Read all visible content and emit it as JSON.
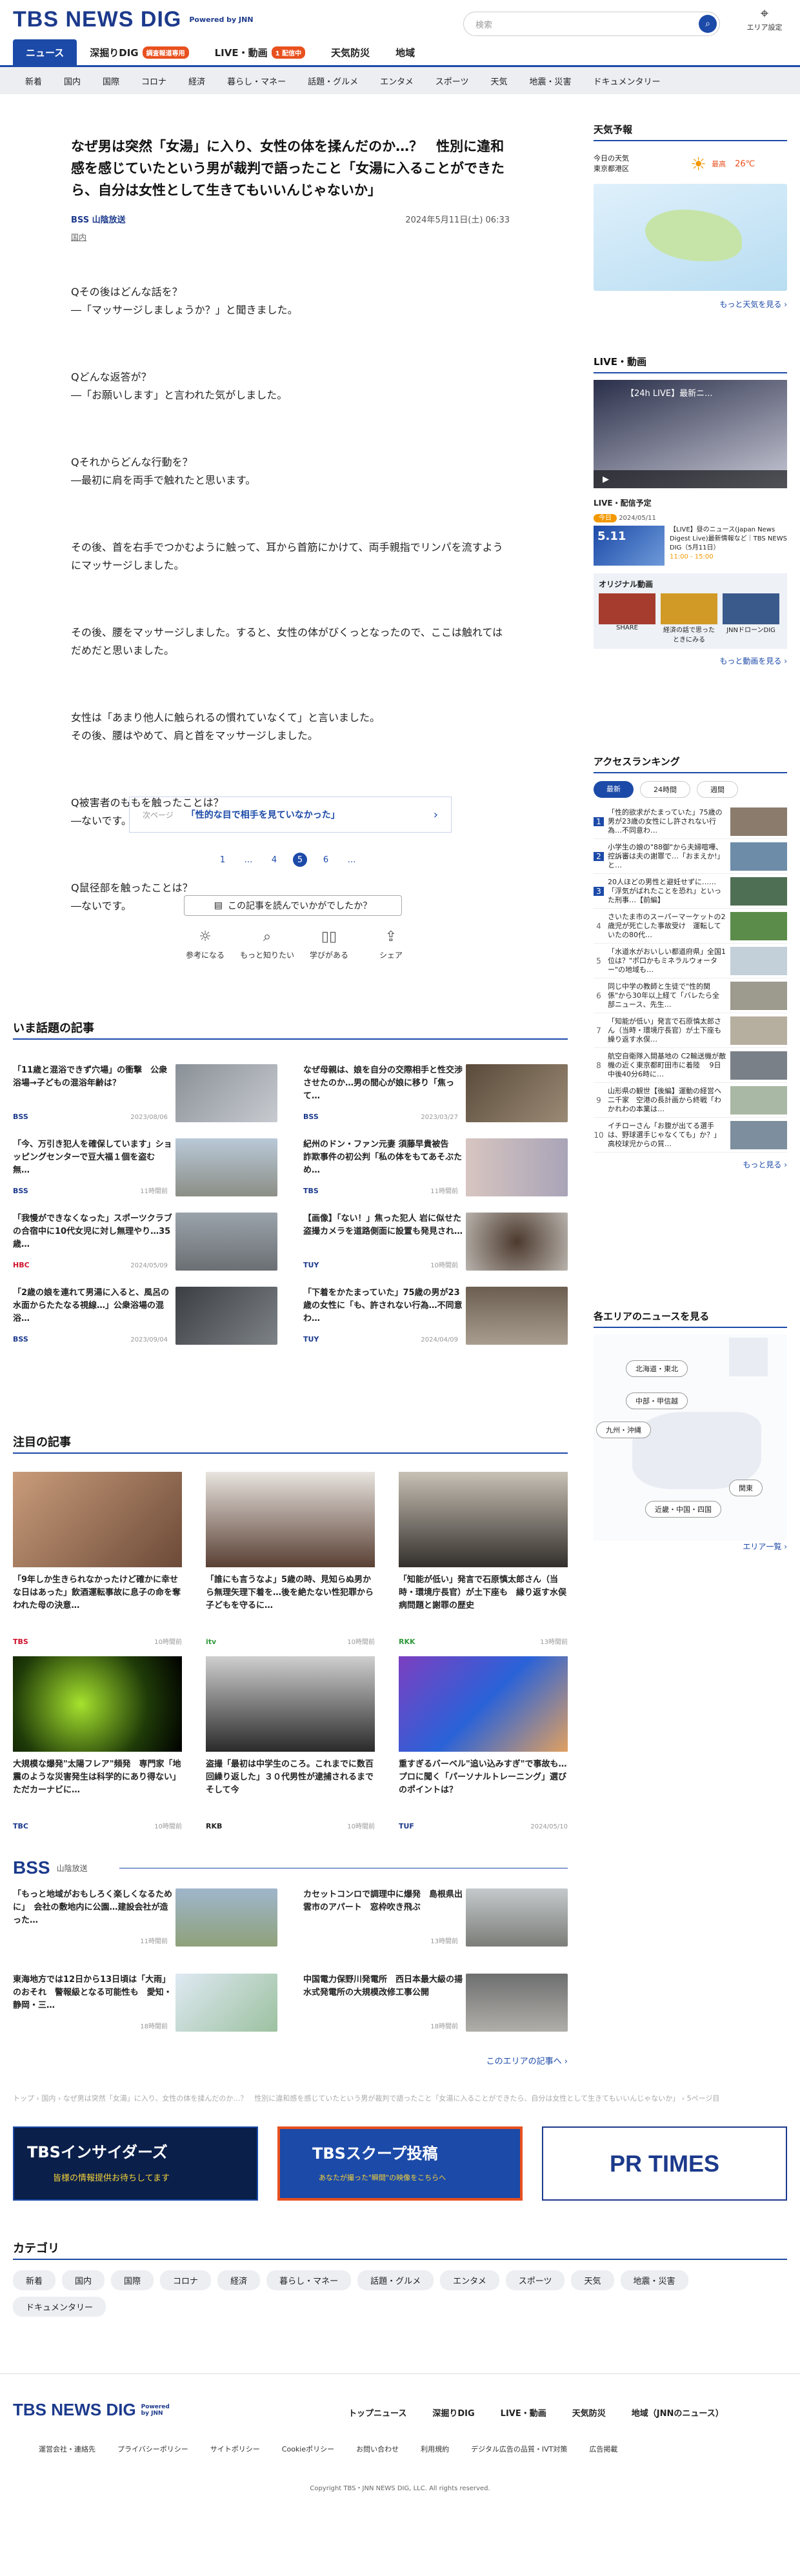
{
  "header": {
    "logo": "TBS NEWS DIG",
    "powered": "Powered by JNN",
    "search_placeholder": "検索",
    "area_label": "エリア設定"
  },
  "main_nav": [
    {
      "label": "ニュース",
      "active": true
    },
    {
      "label": "深掘りDIG",
      "badge": "調査報道専用"
    },
    {
      "label": "LIVE・動画",
      "badge": "1 配信中"
    },
    {
      "label": "天気防災"
    },
    {
      "label": "地域"
    }
  ],
  "sub_nav": [
    "新着",
    "国内",
    "国際",
    "コロナ",
    "経済",
    "暮らし・マネー",
    "話題・グルメ",
    "エンタメ",
    "スポーツ",
    "天気",
    "地震・災害",
    "ドキュメンタリー"
  ],
  "article": {
    "title": "なぜ男は突然「女湯」に入り、女性の体を揉んだのか…？　性別に違和感を感じていたという男が裁判で語ったこと「女湯に入ることができたら、自分は女性として生きてもいいんじゃないか」",
    "source": "BSS 山陰放送",
    "date": "2024年5月11日(土) 06:33",
    "category": "国内",
    "paragraphs": [
      "Qその後はどんな話を？\n―「マッサージしましょうか？」と聞きました。",
      "Qどんな返答が？\n―「お願いします」と言われた気がしました。",
      "Qそれからどんな行動を？\n―最初に肩を両手で触れたと思います。",
      "その後、首を右手でつかむように触って、耳から首筋にかけて、両手親指でリンパを流すようにマッサージしました。",
      "その後、腰をマッサージしました。すると、女性の体がびくっとなったので、ここは触れてはだめだと思いました。",
      "女性は「あまり他人に触られるの慣れていなくて」と言いました。\nその後、腰はやめて、肩と首をマッサージしました。",
      "Q被害者のももを触ったことは？\n―ないです。",
      "Q鼠径部を触ったことは？\n―ないです。"
    ],
    "next_label": "次ページ",
    "next_title": "「性的な目で相手を見ていなかった」",
    "pager": [
      "1",
      "…",
      "4",
      "5",
      "6",
      "…"
    ],
    "feedback_q": "この記事を読んでいかがでしたか？",
    "reactions": [
      "参考になる",
      "もっと知りたい",
      "学びがある",
      "シェア"
    ]
  },
  "trending": {
    "title": "いま話題の記事",
    "items": [
      {
        "text": "「11歳と混浴できず穴場」の衝撃　公衆浴場→子どもの混浴年齢は？",
        "src": "BSS",
        "date": "2023/08/06"
      },
      {
        "text": "なぜ母親は、娘を自分の交際相手と性交渉させたのか…男の間心が娘に移り「焦って…",
        "src": "BSS",
        "date": "2023/03/27"
      },
      {
        "text": "「今、万引き犯人を確保しています」ショッピングセンターで豆大福１個を盗む　無…",
        "src": "BSS",
        "date": "11時間前"
      },
      {
        "text": "紀州のドン・ファン元妻 須藤早貴被告　詐欺事件の初公判「私の体をもてあそぶため…",
        "src": "TBS",
        "date": "11時間前"
      },
      {
        "text": "「我慢ができなくなった」スポーツクラブの合宿中に10代女児に対し無理やり…35歳…",
        "src": "HBC",
        "date": "2024/05/09"
      },
      {
        "text": "【画像】「ない！」焦った犯人 岩に似せた盗撮カメラを道路側面に設置も発見され…",
        "src": "TUY",
        "date": "10時間前"
      },
      {
        "text": "「2歳の娘を連れて男湯に入ると、風呂の水面からたたなる視線…」公衆浴場の混浴…",
        "src": "BSS",
        "date": "2023/09/04"
      },
      {
        "text": "「下着をかたまっていた」75歳の男が23歳の女性に「も、許されない行為…不同意わ…",
        "src": "TUY",
        "date": "2024/04/09"
      }
    ]
  },
  "notable": {
    "title": "注目の記事",
    "items": [
      {
        "text": "「9年しか生きられなかったけど確かに幸せな日はあった」飲酒運転事故に息子の命を奪われた母の決意…",
        "src": "TBS",
        "date": "10時間前"
      },
      {
        "text": "「誰にも言うなよ」5歳の時、見知らぬ男から無理矢理下着を…後を絶たない性犯罪から子どもを守るに…",
        "src": "itv",
        "date": "10時間前"
      },
      {
        "text": "「知能が低い」発言で石原慎太郎さん（当時・環境庁長官）が土下座も　縁り返す水俣病問題と謝罪の歴史",
        "src": "RKK",
        "date": "13時間前"
      },
      {
        "text": "大規模な爆発\"太陽フレア\"頻発　専門家「地震のような災害発生は科学的にあり得ない」ただカーナビに…",
        "src": "TBC",
        "date": "10時間前"
      },
      {
        "text": "盗撮「最初は中学生のころ。これまでに数百回繰り返した」３０代男性が逮捕されるまで　そして今",
        "src": "RKB",
        "date": "10時間前"
      },
      {
        "text": "重すぎるバーベル\"追い込みすぎ\"で事故も…プロに聞く「パーソナルトレーニング」選びのポイントは？",
        "src": "TUF",
        "date": "2024/05/10"
      }
    ]
  },
  "local": {
    "logo": "BSS",
    "title": "山陰放送",
    "items": [
      {
        "text": "「もっと地域がおもしろく楽しくなるために」　会社の敷地内に公園…建設会社が造った…",
        "date": "11時間前"
      },
      {
        "text": "カセットコンロで調理中に爆発　島根県出雲市のアパート　窓枠吹き飛ぶ",
        "date": "13時間前"
      },
      {
        "text": "東海地方では12日から13日頃は「大雨」のおそれ　警報級となる可能性も　愛知・静岡・三…",
        "date": "18時間前"
      },
      {
        "text": "中国電力保野川発電所　西日本最大級の揚水式発電所の大規模改修工事公開",
        "date": "18時間前"
      }
    ],
    "more": "このエリアの記事へ ›"
  },
  "breadcrumb": "トップ › 国内 › なぜ男は突然「女湯」に入り、女性の体を揉んだのか…？　性別に違和感を感じていたという男が裁判で語ったこと「女湯に入ることができたら、自分は女性として生きてもいいんじゃないか」 › 5ページ目",
  "banners": [
    {
      "title": "TBSインサイダーズ",
      "sub": "皆様の情報提供お待ちしてます"
    },
    {
      "title": "TBSスクープ投稿",
      "sub": "あなたが撮った\"瞬間\"の映像をこちらへ"
    },
    {
      "title": "PR TIMES"
    }
  ],
  "categories": {
    "title": "カテゴリ",
    "items": [
      "新着",
      "国内",
      "国際",
      "コロナ",
      "経済",
      "暮らし・マネー",
      "話題・グルメ",
      "エンタメ",
      "スポーツ",
      "天気",
      "地震・災害",
      "ドキュメンタリー"
    ]
  },
  "sidebar": {
    "weather": {
      "title": "天気予報",
      "today": "今日の天気",
      "region": "東京都港区",
      "high_label": "最高",
      "high": "26℃",
      "more": "もっと天気を見る ›"
    },
    "live": {
      "title": "LIVE・動画",
      "player_title": "【24h LIVE】最新ニ...",
      "badge": "LIVE・配信予定",
      "today": "今日",
      "date": "2024/05/11",
      "thumb_date": "5.11",
      "desc": "【LIVE】昼のニュース(Japan News Digest Live)最新情報など｜TBS NEWS DIG（5月11日）",
      "time": "11:00 - 15:00",
      "orig_title": "オリジナル動画",
      "orig": [
        "SHARE",
        "経済の話で思ったときにみる",
        "JNNドローンDIG"
      ],
      "more": "もっと動画を見る ›"
    },
    "ranking": {
      "title": "アクセスランキング",
      "tabs": [
        "最新",
        "24時間",
        "週間"
      ],
      "items": [
        "「性的欲求がたまっていた」75歳の男が23歳の女性にし許されない行為…不同意わ…",
        "小学生の娘の\"88御\"から夫婦喧嘩、控訴審は夫の謝罪で…「おまえか!」と…",
        "20人ほどの男性と避妊せずに……「浮気がばれたことを恐れ」といった刑事…【前編】",
        "さいたま市のスーパーマーケットの2歳児が死亡した事故受け　運転していたの80代…",
        "「水道水がおいしい都道府県」全国1位は？\"ポ口かもミネラルウォーター\"の地域も…",
        "同じ中学の教師と生徒で\"性的関係\"から30年以上経て「バレたら全部ニュース、先生…",
        "「知能が低い」発言で石原慎太郎さん（当時・環境庁長官）が土下座も 繰り返す水俣…",
        "航空自衛隊入間基地の C2輸送機が敵機の近く東京都町田市に着陸 　9日中後40分6時に…",
        "山形県の観世【後編】運動の経営ヘ二千家　空港の長計画から終戦「わかれわの本業は…",
        "イチローさん「お腹が出てる選手は、野球選手じゃなくても」か？」高校球児からの質…"
      ],
      "more": "もっと見る ›"
    },
    "areas": {
      "title": "各エリアのニュースを見る",
      "labels": [
        "北海道・東北",
        "中部・甲信越",
        "九州・沖縄",
        "関東",
        "近畿・中国・四国"
      ],
      "more": "エリア一覧 ›"
    }
  },
  "footer": {
    "logo": "TBS NEWS DIG",
    "powered": "Powered by JNN",
    "nav": [
      "トップニュース",
      "深掘りDIG",
      "LIVE・動画",
      "天気防災",
      "地域（JNNのニュース）"
    ],
    "links": [
      "運営会社・連絡先",
      "プライバシーポリシー",
      "サイトポリシー",
      "Cookieポリシー",
      "お問い合わせ",
      "利用規約",
      "デジタル広告の品質・IVT対策",
      "広告掲載"
    ],
    "copyright": "Copyright TBS・JNN NEWS DIG, LLC. All rights reserved."
  },
  "colors": {
    "brand": "#1c4aa8",
    "accent": "#e8501e"
  }
}
